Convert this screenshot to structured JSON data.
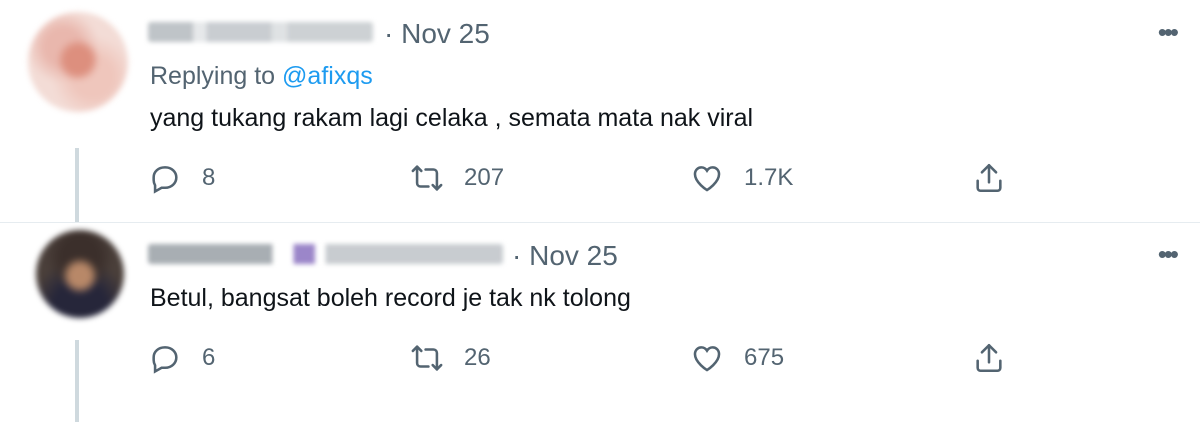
{
  "tweets": [
    {
      "date": "Nov 25",
      "meta": "· Nov 25",
      "replying_prefix": "Replying to",
      "replying_handle": "@afixqs",
      "text": "yang tukang rakam lagi celaka , semata mata nak viral",
      "replies": "8",
      "retweets": "207",
      "likes": "1.7K",
      "more": "•••"
    },
    {
      "date": "Nov 25",
      "meta": "· Nov 25",
      "text": "Betul, bangsat boleh record je tak nk tolong",
      "replies": "6",
      "retweets": "26",
      "likes": "675",
      "more": "•••"
    }
  ],
  "icons": {
    "reply": "reply-icon",
    "retweet": "retweet-icon",
    "like": "heart-icon",
    "share": "share-icon",
    "more": "more-icon"
  },
  "colors": {
    "link": "#1d9bf0",
    "secondary_text": "#536471",
    "primary_text": "#0f1419"
  }
}
